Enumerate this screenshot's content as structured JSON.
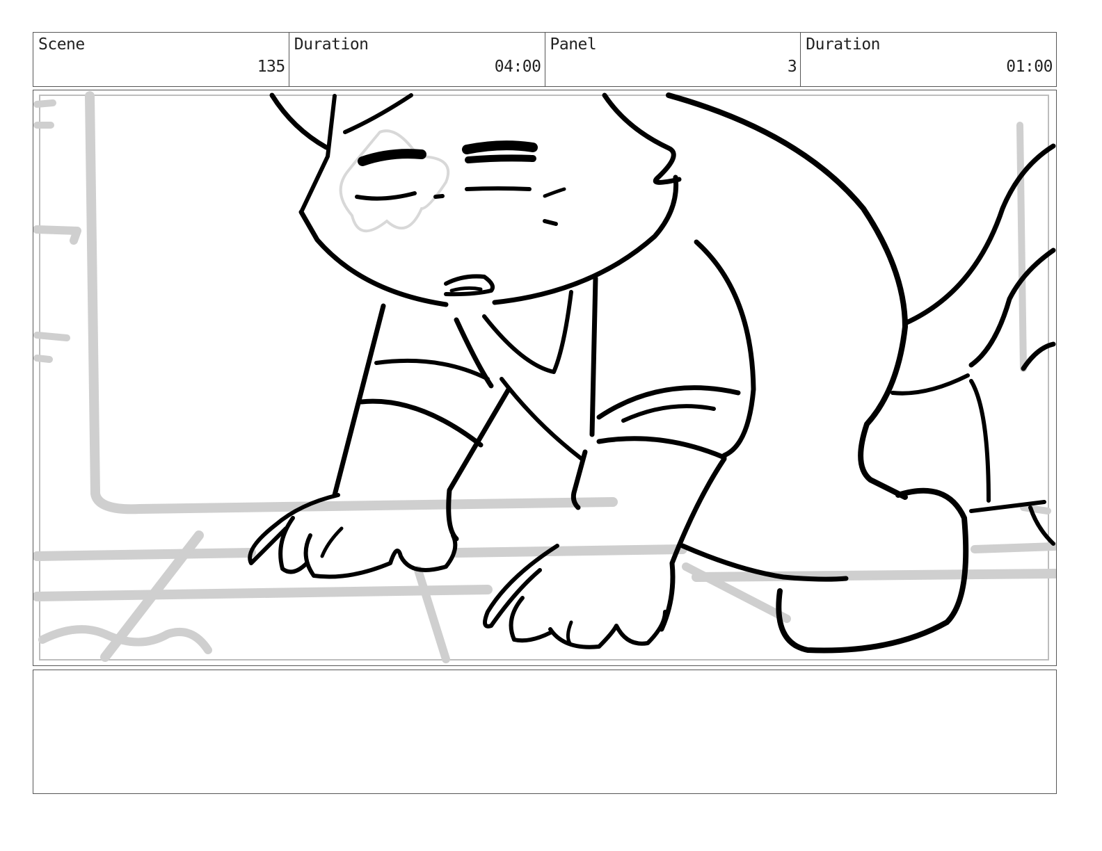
{
  "header": {
    "scene": {
      "label": "Scene",
      "value": "135"
    },
    "scene_duration": {
      "label": "Duration",
      "value": "04:00"
    },
    "panel": {
      "label": "Panel",
      "value": "3"
    },
    "panel_duration": {
      "label": "Duration",
      "value": "01:00"
    }
  },
  "artwork": {
    "description_icon": "storyboard-sketch",
    "line_color": "#000000",
    "background_color": "#cfcfcf"
  },
  "notes": {
    "text": ""
  }
}
